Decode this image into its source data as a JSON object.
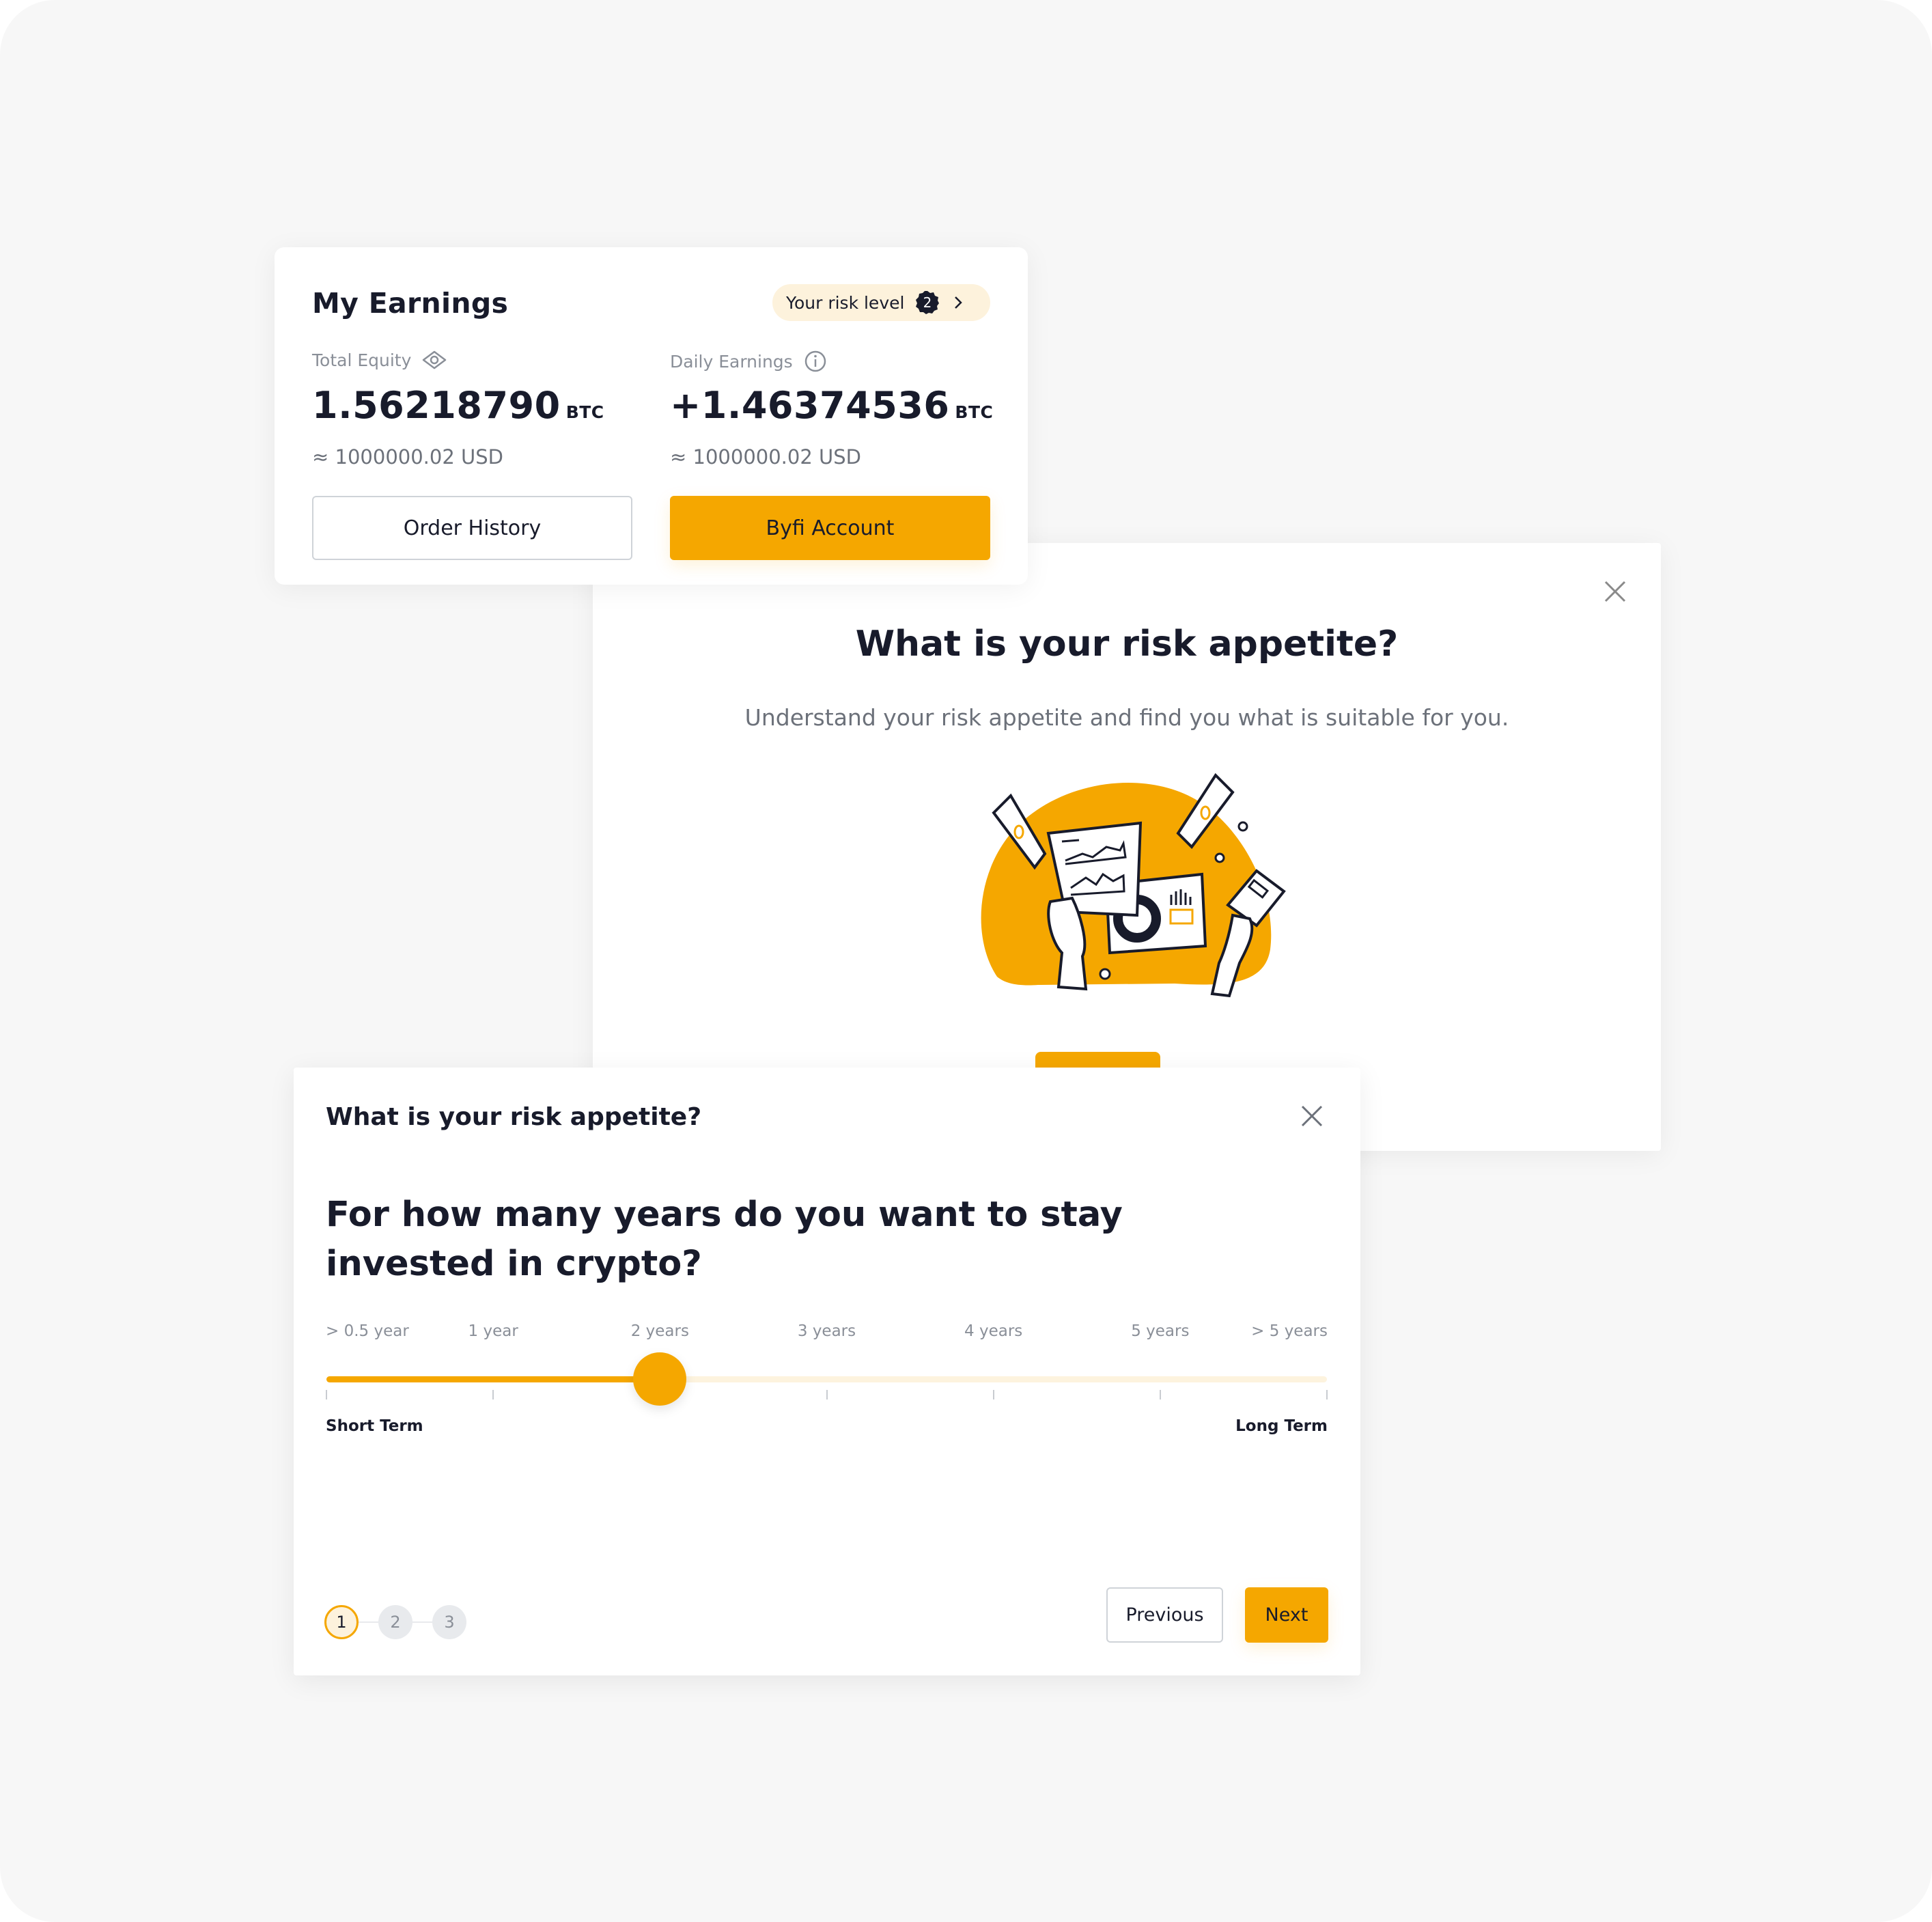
{
  "earnings_card": {
    "title": "My Earnings",
    "risk_pill": {
      "label": "Your risk level",
      "level": "2"
    },
    "total_equity": {
      "label": "Total Equity",
      "value": "1.56218790",
      "unit": "BTC",
      "usd": "≈ 1000000.02 USD"
    },
    "daily_earnings": {
      "label": "Daily Earnings",
      "value": "+1.46374536",
      "unit": "BTC",
      "usd": "≈ 1000000.02 USD"
    },
    "buttons": {
      "order_history": "Order History",
      "byfi_account": "Byfi Account"
    }
  },
  "intro_modal": {
    "title": "What is your risk appetite?",
    "subtitle": "Understand your risk appetite and find you what is suitable for you."
  },
  "question_modal": {
    "header": "What is your risk appetite?",
    "question": "For how many years do you want to stay invested in crypto?",
    "slider": {
      "options": [
        "> 0.5 year",
        "1 year",
        "2 years",
        "3 years",
        "4 years",
        "5 years",
        "> 5 years"
      ],
      "selected_index": 2,
      "min_label": "Short Term",
      "max_label": "Long Term"
    },
    "steps": [
      "1",
      "2",
      "3"
    ],
    "current_step": 1,
    "buttons": {
      "previous": "Previous",
      "next": "Next"
    }
  },
  "colors": {
    "accent": "#f5a700",
    "accent_light": "#fdf2dc",
    "text": "#181b2b",
    "muted": "#8a8f98",
    "background": "#f7f7f7"
  }
}
